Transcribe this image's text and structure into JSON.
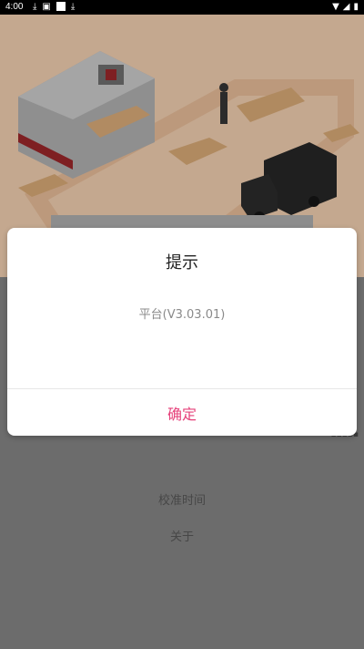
{
  "statusbar": {
    "time": "4:00",
    "left_icons": [
      "download-icon",
      "notification-icon",
      "square-icon",
      "download-icon"
    ],
    "right_icons": [
      "wifi-icon",
      "signal-icon",
      "battery-icon"
    ]
  },
  "hero": {
    "illustration": "warehouse-logistics-illustration"
  },
  "background_menu": {
    "items": [
      {
        "label": "校准时间"
      },
      {
        "label": "关于"
      }
    ]
  },
  "dialog": {
    "title": "提示",
    "message": "平台(V3.03.01)",
    "confirm_label": "确定",
    "accent_color": "#e6407a"
  }
}
